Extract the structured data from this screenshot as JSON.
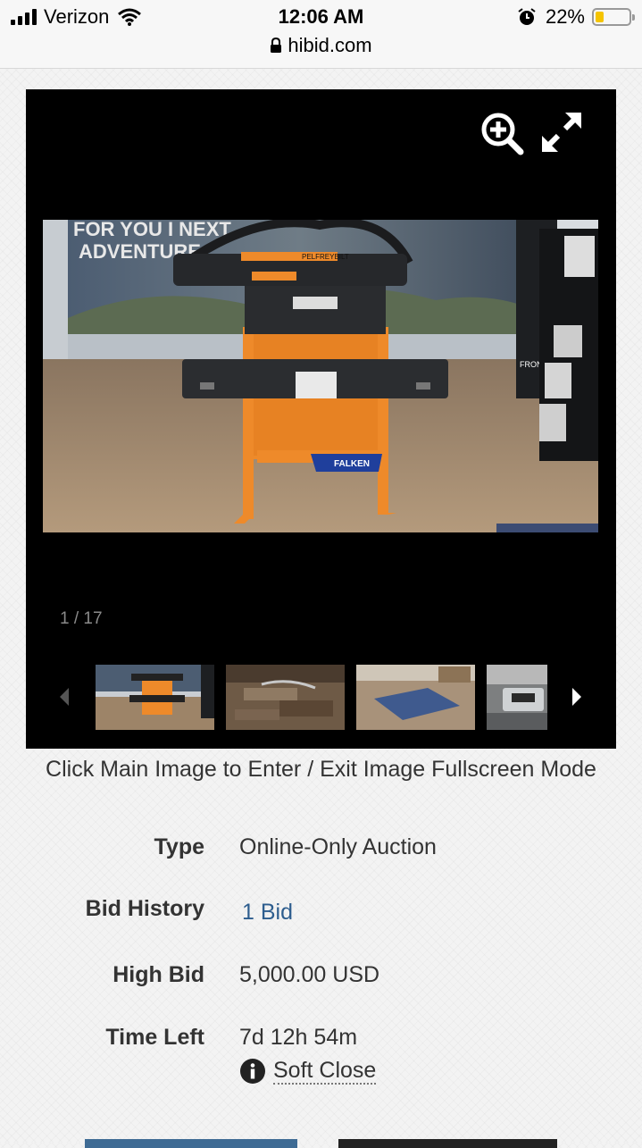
{
  "status_bar": {
    "carrier": "Verizon",
    "time": "12:06 AM",
    "battery": "22%",
    "url": "hibid.com"
  },
  "viewer": {
    "counter": "1 / 17",
    "zoom_icon": "zoom-in-icon",
    "fullscreen_icon": "expand-icon",
    "image_text": {
      "banner_line1": "FOR YOU I NEXT",
      "banner_line2": "ADVENTURE",
      "bumper_brand": "PELFREYBILT",
      "bag_brand": "FALKEN",
      "right_panel": "FRONT RUNNER"
    },
    "thumbnail_count_visible": 4
  },
  "caption": "Click Main Image to Enter / Exit Image Fullscreen Mode",
  "details": {
    "type_label": "Type",
    "type_value": "Online-Only Auction",
    "bid_history_label": "Bid History",
    "bid_history_value": "1 Bid",
    "high_bid_label": "High Bid",
    "high_bid_value": "5,000.00 USD",
    "time_left_label": "Time Left",
    "time_left_value": "7d 12h 54m",
    "soft_close": "Soft Close"
  },
  "colors": {
    "link": "#2d5d8e",
    "battery": "#f5c400",
    "product_orange": "#ee8a2a"
  }
}
